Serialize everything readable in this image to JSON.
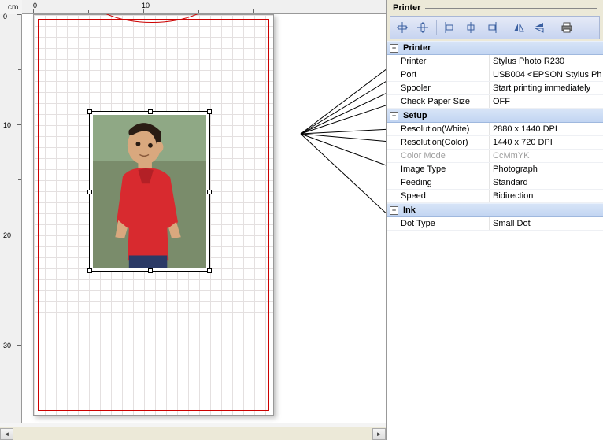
{
  "canvas": {
    "unit": "cm",
    "ruler_top": [
      "0",
      "10"
    ],
    "ruler_left": [
      "0",
      "10",
      "20",
      "30"
    ]
  },
  "panel": {
    "title": "Printer",
    "toolbar": {
      "center_h": "Center horizontally",
      "center_v": "Center vertically",
      "align_left": "Align left",
      "align_center": "Align center",
      "align_right": "Align right",
      "mirror_h": "Mirror horizontal",
      "mirror_v": "Mirror vertical",
      "print": "Print"
    }
  },
  "props": {
    "groups": [
      {
        "name": "Printer",
        "rows": [
          {
            "label": "Printer",
            "value": "Stylus Photo R230"
          },
          {
            "label": "Port",
            "value": "USB004  <EPSON Stylus Ph"
          },
          {
            "label": "Spooler",
            "value": "Start printing immediately"
          },
          {
            "label": "Check Paper Size",
            "value": "OFF"
          }
        ]
      },
      {
        "name": "Setup",
        "rows": [
          {
            "label": "Resolution(White)",
            "value": "2880 x 1440 DPI"
          },
          {
            "label": "Resolution(Color)",
            "value": "1440 x 720 DPI"
          },
          {
            "label": "Color Mode",
            "value": "CcMmYK",
            "disabled": true
          },
          {
            "label": "Image Type",
            "value": "Photograph"
          },
          {
            "label": "Feeding",
            "value": "Standard"
          },
          {
            "label": "Speed",
            "value": "Bidirection"
          }
        ]
      },
      {
        "name": "Ink",
        "rows": [
          {
            "label": "Dot Type",
            "value": "Small Dot"
          }
        ]
      }
    ]
  }
}
